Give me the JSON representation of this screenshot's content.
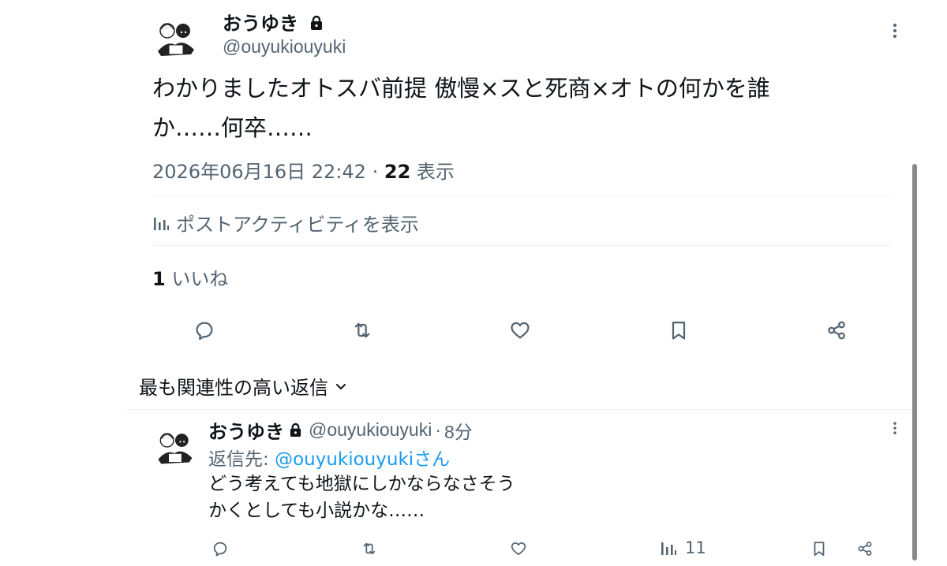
{
  "post": {
    "display_name": "おうゆき",
    "handle": "@ouyukiouyuki",
    "text_line1": "わかりましたオトスバ前提 傲慢×スと死商×オトの何かを誰",
    "text_line2": "か……何卒……",
    "timestamp": "2026年06月16日 22:42",
    "separator": "·",
    "views_count": "22",
    "views_label": "表示",
    "activity_label": "ポストアクティビティを表示",
    "likes_count": "1",
    "likes_label": "いいね"
  },
  "replies_sort": {
    "label": "最も関連性の高い返信"
  },
  "reply": {
    "display_name": "おうゆき",
    "handle": "@ouyukiouyuki",
    "separator": "·",
    "time": "8分",
    "replying_to_prefix": "返信先: ",
    "replying_to_handle": "@ouyukiouyukiさん",
    "text_line1": "どう考えても地獄にしかならなさそう",
    "text_line2": "かくとしても小説かな……",
    "views_count": "11"
  },
  "icons": [
    "lock-icon",
    "more-icon",
    "analytics-icon",
    "reply-icon",
    "repost-icon",
    "like-icon",
    "bookmark-icon",
    "share-icon",
    "chevron-down-icon"
  ],
  "colors": {
    "text": "#0f1419",
    "muted": "#536471",
    "link": "#1d9bf0",
    "divider": "#eff3f4"
  }
}
